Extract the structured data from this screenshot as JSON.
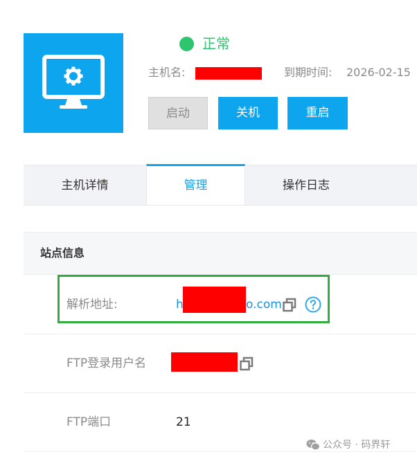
{
  "host": {
    "status": "正常",
    "host_label": "主机名:",
    "expire_label": "到期时间:",
    "expire_value": "2026-02-15",
    "status_color": "#2ec56e",
    "accent_color": "#0ea5ef",
    "icon": "monitor-gear-icon"
  },
  "actions": {
    "start": "启动",
    "shutdown": "关机",
    "restart": "重启"
  },
  "tabs": [
    {
      "label": "主机详情",
      "active": false
    },
    {
      "label": "管理",
      "active": true
    },
    {
      "label": "操作日志",
      "active": false
    }
  ],
  "site_info": {
    "title": "站点信息",
    "rows": [
      {
        "label": "解析地址:",
        "value_prefix": "h",
        "value_suffix": "o.com",
        "copy_icon": "copy-icon",
        "help_icon": "help-icon"
      },
      {
        "label": "FTP登录用户名",
        "copy_icon": "copy-icon"
      },
      {
        "label": "FTP端口",
        "value": "21"
      }
    ]
  },
  "watermark": {
    "text": "公众号 · 码界轩",
    "icon": "wechat-icon"
  }
}
